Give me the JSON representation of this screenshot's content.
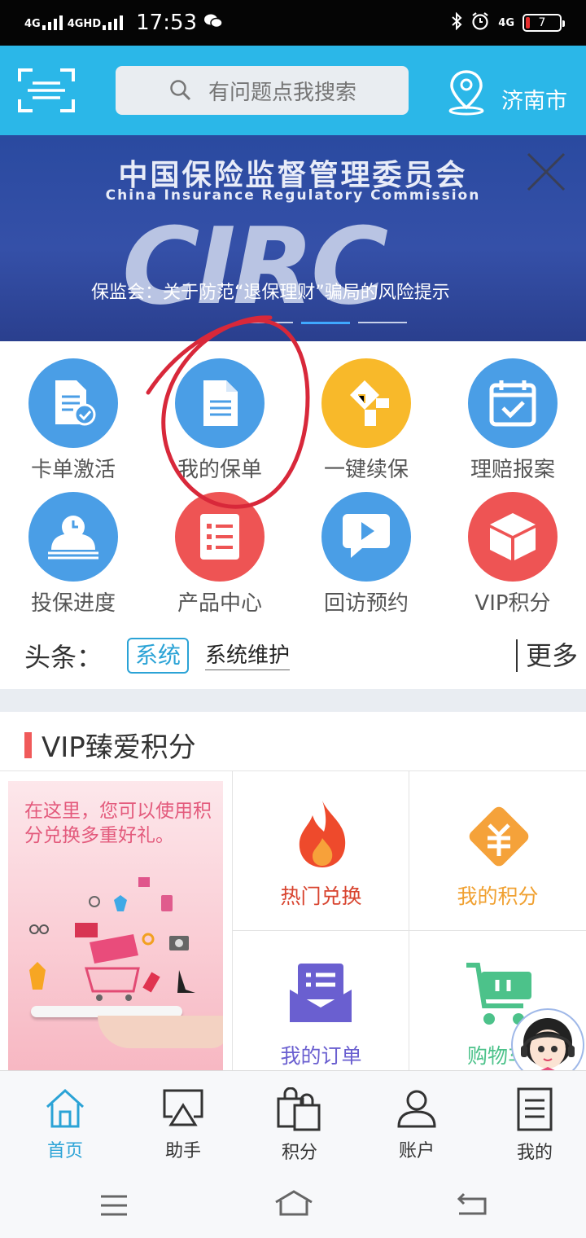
{
  "status_bar": {
    "signal_1": "4G",
    "signal_2": "4GHD",
    "time": "17:53",
    "network_right": "4G",
    "battery": "7"
  },
  "header": {
    "search_placeholder": "有问题点我搜索",
    "city": "济南市"
  },
  "banner": {
    "org_cn": "中国保险监督管理委员会",
    "org_en": "China Insurance Regulatory Commission",
    "logo_text": "CIRC",
    "caption": "保监会：关于防范“退保理财”骗局的风险提示"
  },
  "grid": {
    "items": [
      {
        "label": "卡单激活",
        "icon": "card-activate-icon",
        "color": "#4a9ee6"
      },
      {
        "label": "我的保单",
        "icon": "policy-document-icon",
        "color": "#4a9ee6"
      },
      {
        "label": "一键续保",
        "icon": "renew-icon",
        "color": "#f8b92a"
      },
      {
        "label": "理赔报案",
        "icon": "calendar-check-icon",
        "color": "#4a9ee6"
      },
      {
        "label": "投保进度",
        "icon": "progress-clock-icon",
        "color": "#4a9ee6"
      },
      {
        "label": "产品中心",
        "icon": "product-list-icon",
        "color": "#ee5454"
      },
      {
        "label": "回访预约",
        "icon": "chat-play-icon",
        "color": "#4a9ee6"
      },
      {
        "label": "VIP积分",
        "icon": "box-icon",
        "color": "#ee5454"
      }
    ]
  },
  "headline": {
    "title": "头条：",
    "tag": "系统",
    "text": "系统维护",
    "more": "更多"
  },
  "vip": {
    "section_title": "VIP臻爱积分",
    "promo_text": "在这里，您可以使用积分兑换多重好礼。",
    "cells": [
      {
        "label": "热门兑换",
        "color": "#d8442f",
        "icon": "fire-icon"
      },
      {
        "label": "我的积分",
        "color": "#f0a030",
        "icon": "points-icon"
      },
      {
        "label": "我的订单",
        "color": "#6a5fd0",
        "icon": "order-icon"
      },
      {
        "label": "购物车",
        "color": "#4cc28a",
        "icon": "cart-icon"
      }
    ]
  },
  "tabbar": {
    "items": [
      {
        "label": "首页",
        "icon": "home-icon",
        "active": true
      },
      {
        "label": "助手",
        "icon": "airplay-icon",
        "active": false
      },
      {
        "label": "积分",
        "icon": "shopping-bags-icon",
        "active": false
      },
      {
        "label": "账户",
        "icon": "user-icon",
        "active": false
      },
      {
        "label": "我的",
        "icon": "document-icon",
        "active": false
      }
    ]
  },
  "colors": {
    "header_bg": "#2bb7e8",
    "accent": "#2ba3d6",
    "annotation_circle": "#d8283a"
  }
}
